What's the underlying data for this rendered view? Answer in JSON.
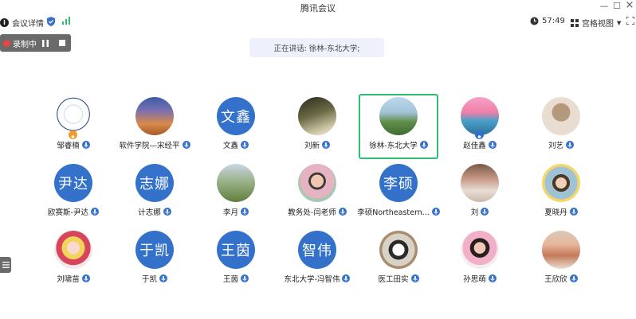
{
  "window": {
    "title": "腾讯会议"
  },
  "toolbar": {
    "meeting_info": "会议详情",
    "timer": "57:49",
    "view_mode": "宫格视图"
  },
  "recording": {
    "label": "录制中"
  },
  "speaking": {
    "text": "正在讲话: 徐林-东北大学;"
  },
  "participants": [
    {
      "name": "邹睿楠",
      "avatar": "university-logo",
      "host": true
    },
    {
      "name": "软件学院—宋经平",
      "avatar": "cathedral-photo"
    },
    {
      "name": "文鑫",
      "avatar_text": "文鑫"
    },
    {
      "name": "刘新",
      "avatar": "forest-photo"
    },
    {
      "name": "徐林-东北大学",
      "avatar": "park-photo",
      "active": true
    },
    {
      "name": "赵佳鑫",
      "avatar": "sunset-photo",
      "host": true
    },
    {
      "name": "刘艺",
      "avatar": "hat-photo"
    },
    {
      "name": "欧赛斯-尹达",
      "avatar_text": "尹达"
    },
    {
      "name": "计志娜",
      "avatar_text": "志娜"
    },
    {
      "name": "李月",
      "avatar": "field-photo"
    },
    {
      "name": "教务处-闫老师",
      "avatar": "child-photo"
    },
    {
      "name": "李硕Northeastern...",
      "avatar_text": "李硕"
    },
    {
      "name": "刘",
      "avatar": "garden-photo"
    },
    {
      "name": "夏晓丹",
      "avatar": "kid-photo"
    },
    {
      "name": "刘啸苗",
      "avatar": "anime-photo"
    },
    {
      "name": "于凯",
      "avatar_text": "于凯"
    },
    {
      "name": "王茵",
      "avatar_text": "王茵"
    },
    {
      "name": "东北大学-冯智伟",
      "avatar_text": "智伟"
    },
    {
      "name": "医工田实",
      "avatar": "panda-photo"
    },
    {
      "name": "孙思萌",
      "avatar": "girl-photo"
    },
    {
      "name": "王欣欣",
      "avatar": "toys-photo"
    }
  ],
  "colors": {
    "accent": "#3371cb",
    "active_border": "#2fbf71",
    "recording": "#e64545",
    "host_badge": "#f39b2c"
  }
}
